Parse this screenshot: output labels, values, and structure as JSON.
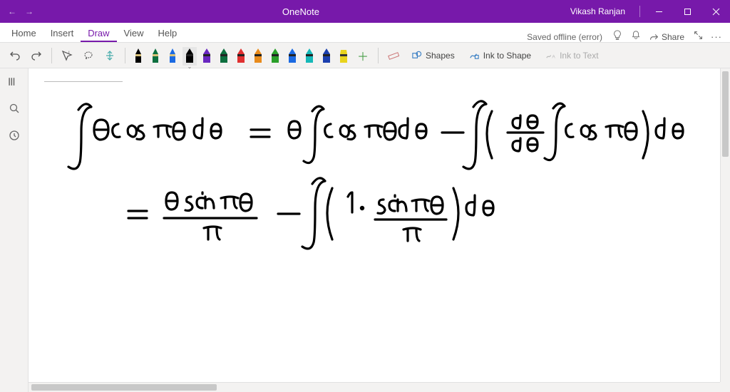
{
  "app": {
    "title": "OneNote",
    "user": "Vikash Ranjan"
  },
  "ribbon": {
    "tabs": [
      "Home",
      "Insert",
      "Draw",
      "View",
      "Help"
    ],
    "active_index": 2,
    "save_status": "Saved offline (error)",
    "share_label": "Share"
  },
  "toolbar": {
    "pens": [
      {
        "color": "#000000",
        "kind": "pen"
      },
      {
        "color": "#0d6f3f",
        "kind": "pen"
      },
      {
        "color": "#1b6ae2",
        "kind": "pen"
      },
      {
        "color": "#000000",
        "kind": "marker"
      },
      {
        "color": "#6927c0",
        "kind": "marker"
      },
      {
        "color": "#0d6f3f",
        "kind": "marker"
      },
      {
        "color": "#e03030",
        "kind": "marker"
      },
      {
        "color": "#e88b1c",
        "kind": "marker"
      },
      {
        "color": "#2a9f2a",
        "kind": "marker"
      },
      {
        "color": "#1b6ae2",
        "kind": "marker"
      },
      {
        "color": "#15b8b8",
        "kind": "marker"
      },
      {
        "color": "#1b3fae",
        "kind": "marker"
      },
      {
        "color": "#e8d31c",
        "kind": "highlighter"
      }
    ],
    "selected_pen_index": 3,
    "shapes_label": "Shapes",
    "ink_to_shape_label": "Ink to Shape",
    "ink_to_text_label": "Ink to Text"
  },
  "leftbar": {
    "items": [
      "notebooks",
      "search",
      "recent"
    ]
  },
  "canvas": {
    "note": "Two lines of handwritten math: an integration-by-parts expansion of ∫ θ cos(πθ) dθ."
  }
}
